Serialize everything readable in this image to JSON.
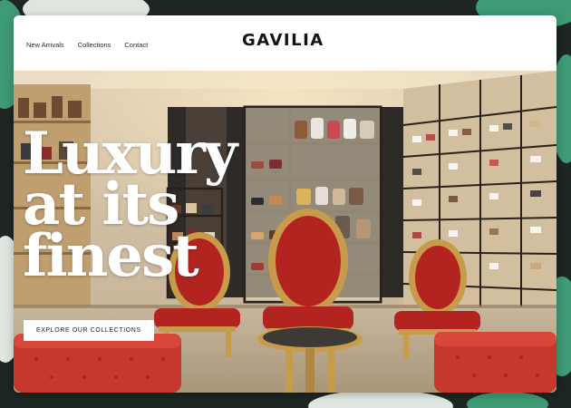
{
  "nav": {
    "links": [
      "New Arrivals",
      "Collections",
      "Contact"
    ],
    "logo": "GAVILIA"
  },
  "hero": {
    "headline_lines": [
      "Luxury",
      "at its",
      "finest"
    ],
    "cta_label": "EXPLORE OUR COLLECTIONS",
    "image_alt": "Shoe boutique interior with red velvet chairs and ottomans"
  },
  "colors": {
    "background": "#1d2622",
    "decor_green": "#3f9a76",
    "decor_light": "#dfe6e1",
    "velvet_red": "#b3231f",
    "gold": "#c89b4a"
  }
}
